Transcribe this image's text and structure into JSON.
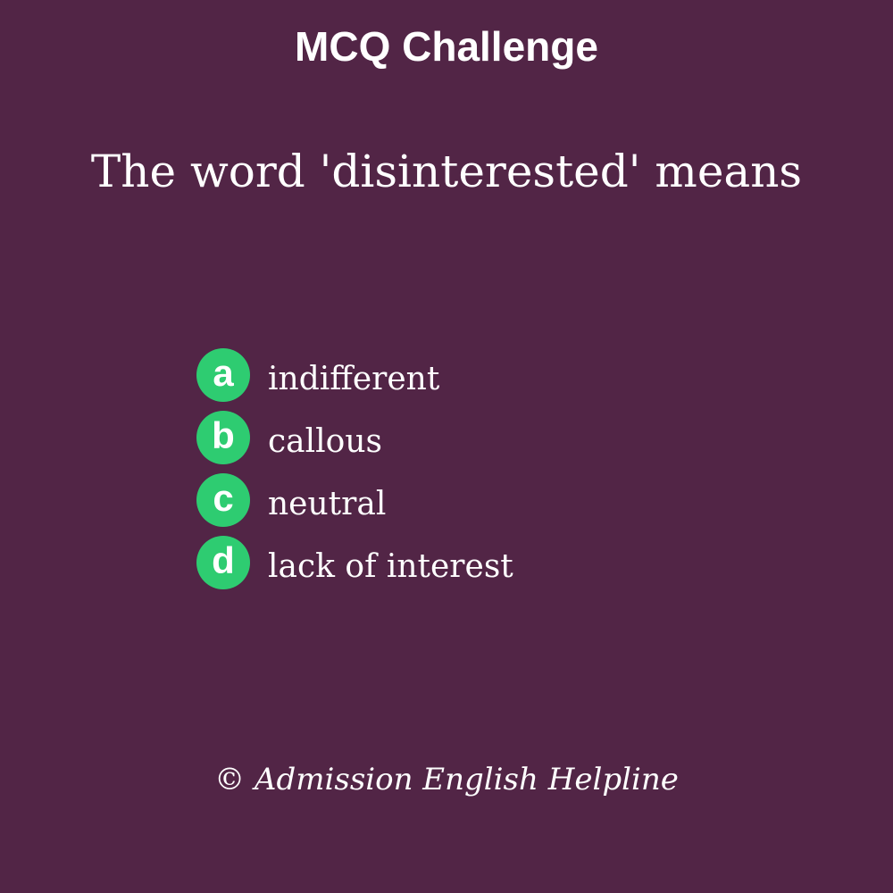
{
  "header": {
    "title": "MCQ Challenge"
  },
  "question": {
    "text": "The word 'disinterested' means"
  },
  "options": [
    {
      "letter": "a",
      "text": "indifferent"
    },
    {
      "letter": "b",
      "text": "callous"
    },
    {
      "letter": "c",
      "text": "neutral"
    },
    {
      "letter": "d",
      "text": "lack of interest"
    }
  ],
  "footer": {
    "copyright": "© Admission English Helpline"
  },
  "colors": {
    "background": "#522546",
    "badge": "#2ecc71",
    "text": "#ffffff"
  }
}
